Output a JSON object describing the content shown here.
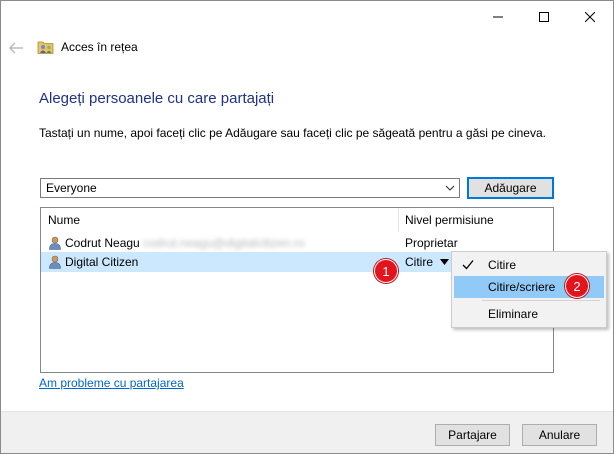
{
  "window": {
    "title": "Acces în rețea"
  },
  "main": {
    "heading": "Alegeți persoanele cu care partajați",
    "instruction": "Tastați un nume, apoi faceți clic pe Adăugare sau faceți clic pe săgeată pentru a găsi pe cineva.",
    "combo_value": "Everyone",
    "add_label": "Adăugare"
  },
  "list": {
    "columns": [
      "Nume",
      "Nivel permisiune"
    ],
    "rows": [
      {
        "name": "Codrut Neagu",
        "email": "codrut.neagu@digitalcitizen.ro",
        "permission": "Proprietar"
      },
      {
        "name": "Digital Citizen",
        "permission": "Citire"
      }
    ]
  },
  "menu": {
    "items": [
      "Citire",
      "Citire/scriere",
      "Eliminare"
    ],
    "checked_item": "Citire",
    "highlighted_item": "Citire/scriere"
  },
  "badges": [
    "1",
    "2"
  ],
  "help_link": "Am probleme cu partajarea",
  "footer": {
    "share_label": "Partajare",
    "cancel_label": "Anulare"
  },
  "icons": {
    "back": "back-arrow-icon",
    "app": "network-share-icon",
    "user": "user-icon",
    "check": "checkmark-icon"
  },
  "colors": {
    "heading": "#1e3287",
    "selection": "#cce8ff",
    "menu_highlight": "#91c9f7",
    "badge": "#e3141b",
    "link": "#0066cc",
    "accent_border": "#0078d7"
  }
}
